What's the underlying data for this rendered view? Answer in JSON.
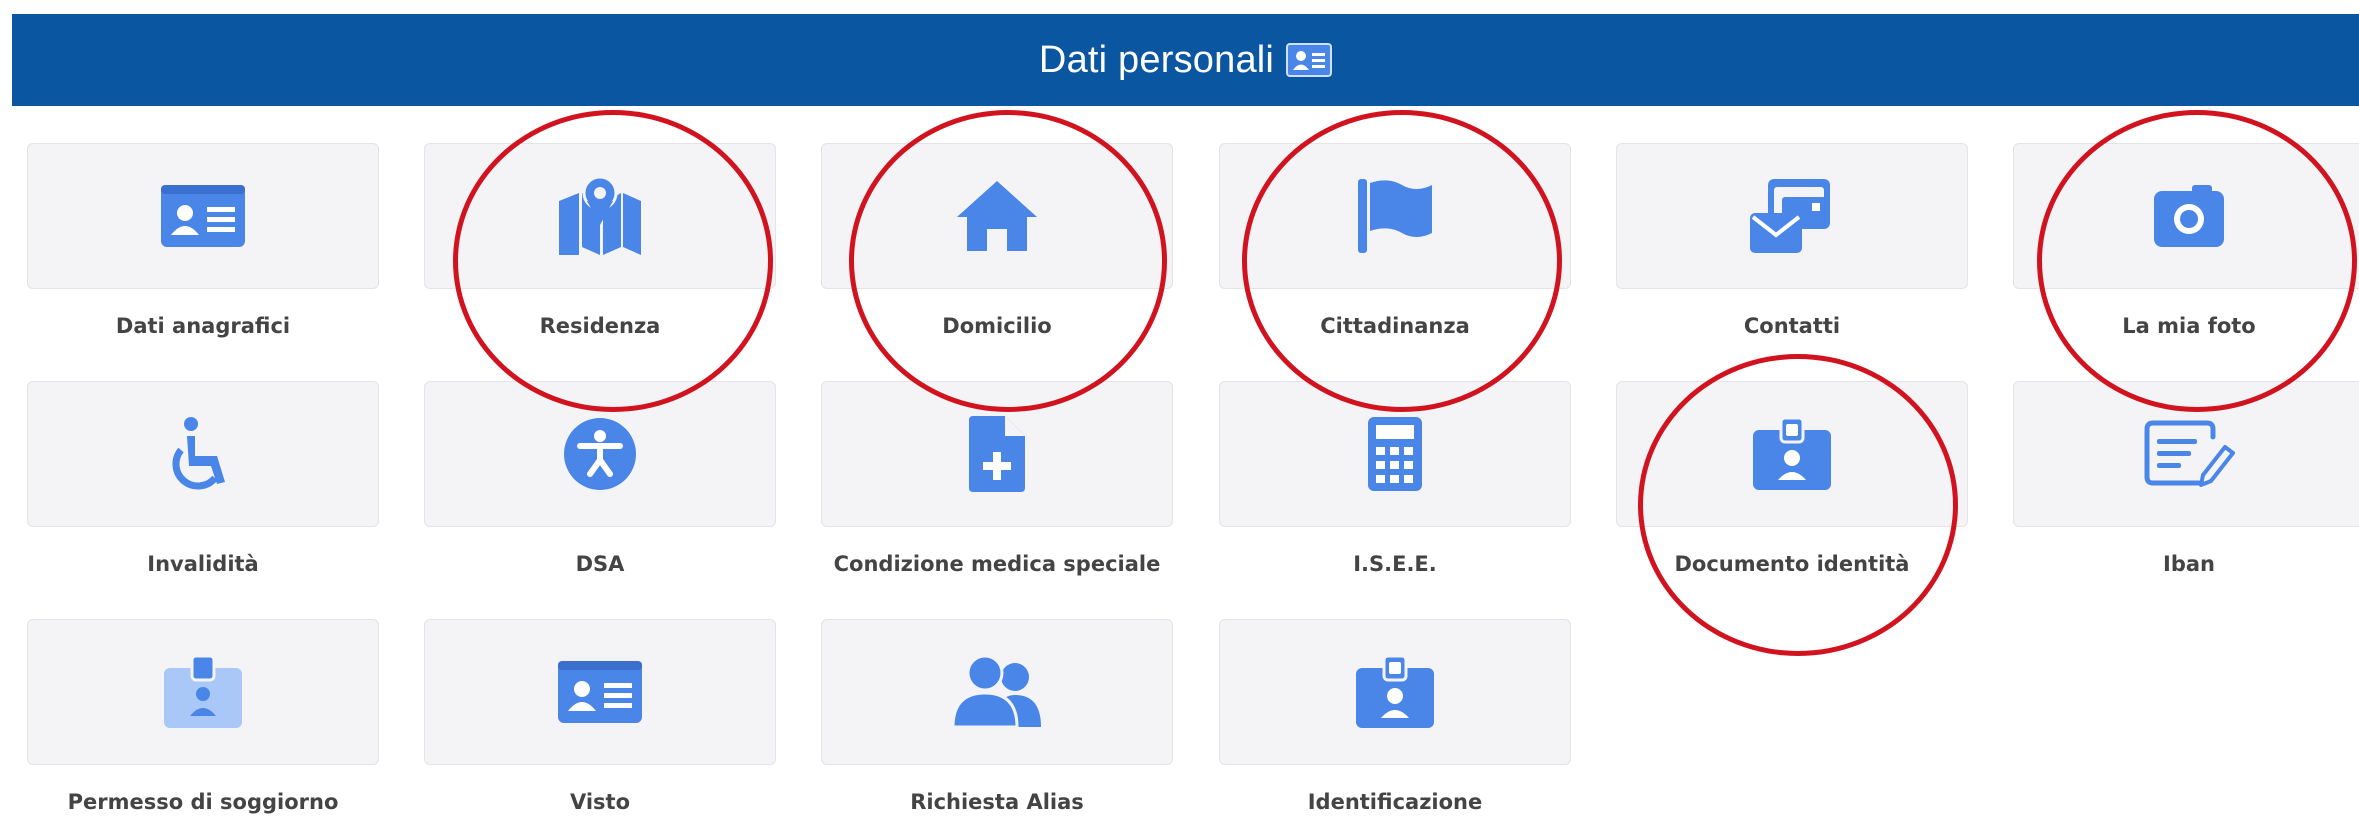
{
  "header": {
    "title": "Dati personali",
    "icon": "id-card-icon"
  },
  "accent_color": "#4a86e8",
  "header_color": "#0a56a0",
  "highlight_color": "#d1131f",
  "items": [
    {
      "label": "Dati anagrafici",
      "icon": "id-card-icon"
    },
    {
      "label": "Residenza",
      "icon": "map-icon"
    },
    {
      "label": "Domicilio",
      "icon": "home-icon"
    },
    {
      "label": "Cittadinanza",
      "icon": "flag-icon"
    },
    {
      "label": "Contatti",
      "icon": "contacts-envelope-icon"
    },
    {
      "label": "La mia foto",
      "icon": "camera-icon"
    },
    {
      "label": "Invalidità",
      "icon": "wheelchair-icon"
    },
    {
      "label": "DSA",
      "icon": "accessibility-icon"
    },
    {
      "label": "Condizione medica speciale",
      "icon": "medical-file-icon"
    },
    {
      "label": "I.S.E.E.",
      "icon": "calculator-icon"
    },
    {
      "label": "Documento identità",
      "icon": "id-badge-icon"
    },
    {
      "label": "Iban",
      "icon": "signature-icon"
    },
    {
      "label": "Permesso di soggiorno",
      "icon": "id-badge-light-icon"
    },
    {
      "label": "Visto",
      "icon": "id-card-icon"
    },
    {
      "label": "Richiesta Alias",
      "icon": "users-icon"
    },
    {
      "label": "Identificazione",
      "icon": "id-badge-icon"
    }
  ]
}
